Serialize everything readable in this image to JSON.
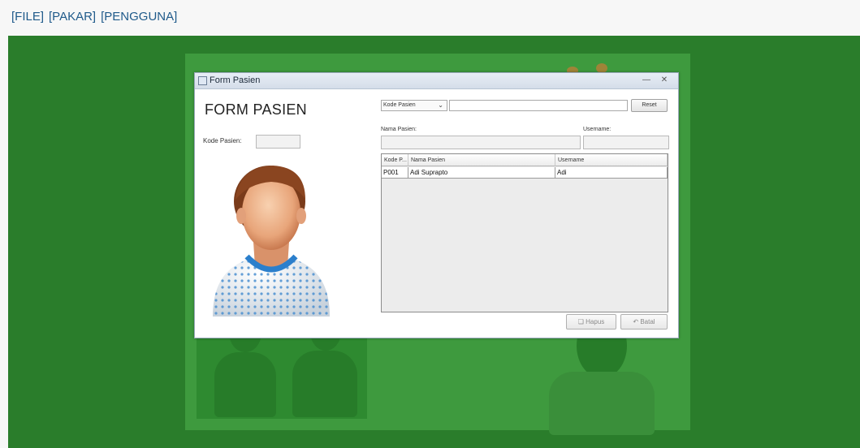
{
  "menu": {
    "items": [
      "[FILE]",
      "[PAKAR]",
      "[PENGGUNA]"
    ]
  },
  "dialog": {
    "window_title": "Form Pasien",
    "form_title": "FORM PASIEN",
    "kode_label": "Kode Pasien:",
    "search_combo_value": "Kode Pasien",
    "reset_label": "Reset",
    "nama_label": "Nama Pasien:",
    "username_label": "Username:",
    "table": {
      "columns": [
        "Kode P...",
        "Nama Pasien",
        "Username"
      ],
      "rows": [
        [
          "P001",
          "Adi Suprapto",
          "Adi"
        ]
      ]
    },
    "hapus_label": "Hapus",
    "batal_label": "Batal"
  },
  "colors": {
    "background_green": "#2a7d2b",
    "panel_green": "#3e9a3e",
    "menu_text": "#1f5a8a"
  }
}
